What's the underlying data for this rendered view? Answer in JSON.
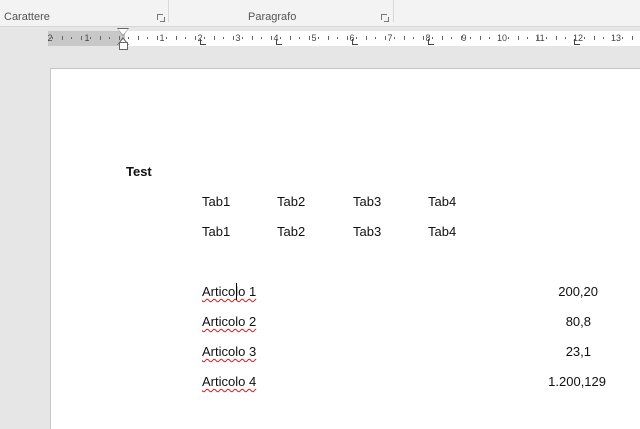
{
  "ribbon": {
    "groups": [
      {
        "label": "Carattere"
      },
      {
        "label": "Paragrafo"
      }
    ]
  },
  "ruler": {
    "left_labels": [
      "2",
      "1"
    ],
    "labels": [
      "1",
      "2",
      "3",
      "4",
      "5",
      "6",
      "7",
      "8",
      "9",
      "10",
      "11",
      "12",
      "13"
    ]
  },
  "document": {
    "heading": "Test",
    "tab_rows": [
      [
        "Tab1",
        "Tab2",
        "Tab3",
        "Tab4"
      ],
      [
        "Tab1",
        "Tab2",
        "Tab3",
        "Tab4"
      ]
    ],
    "articles": [
      {
        "name": "Articolo 1",
        "value": "200,20"
      },
      {
        "name": "Articolo 2",
        "value": "80,8"
      },
      {
        "name": "Articolo 3",
        "value": "23,1"
      },
      {
        "name": "Articolo 4",
        "value": "1.200,129"
      }
    ],
    "spell_error_color": "#d11a1a"
  }
}
